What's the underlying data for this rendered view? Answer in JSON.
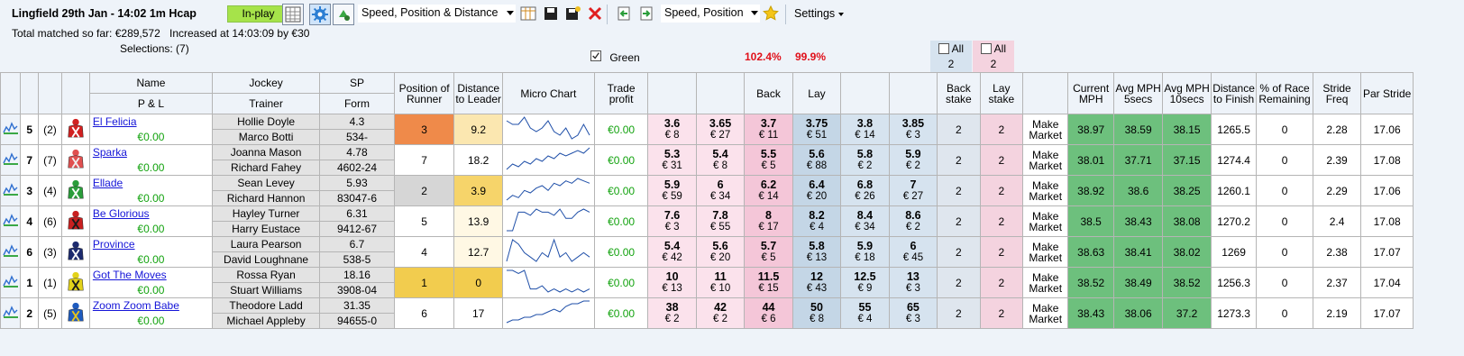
{
  "header": {
    "race_title": "Lingfield 29th Jan - 14:02 1m Hcap",
    "status": "In-play",
    "view_select": "Speed, Position & Distance",
    "layout_select": "Speed, Position",
    "settings": "Settings",
    "total_matched": "Total matched so far: €289,572",
    "increased": "Increased at 14:03:09 by €30",
    "selections": "Selections: (7)",
    "green_label": "Green",
    "back_book": "102.4%",
    "lay_book": "99.9%",
    "all_back_label": "All",
    "all_back_value": "2",
    "all_lay_label": "All",
    "all_lay_value": "2"
  },
  "columns": {
    "name": "Name",
    "pl": "P & L",
    "jockey": "Jockey",
    "trainer": "Trainer",
    "sp": "SP",
    "form": "Form",
    "position": "Position of Runner",
    "distance_leader": "Distance to Leader",
    "micro_chart": "Micro Chart",
    "trade_profit": "Trade profit",
    "back": "Back",
    "lay": "Lay",
    "back_stake": "Back stake",
    "lay_stake": "Lay stake",
    "current_mph": "Current MPH",
    "avg5": "Avg MPH 5secs",
    "avg10": "Avg MPH 10secs",
    "dist_finish": "Distance to Finish",
    "pct_remaining": "% of Race Remaining",
    "stride_freq": "Stride Freq",
    "par_stride": "Par Stride"
  },
  "runners": [
    {
      "num": "5",
      "draw": "(2)",
      "name": "El Felicia",
      "pl": "€0.00",
      "jockey": "Hollie Doyle",
      "trainer": "Marco Botti",
      "sp": "4.3",
      "form": "534-",
      "position": "3",
      "pos_color": "#ef8a4a",
      "dist": "9.2",
      "dist_color": "#fbe7b0",
      "trade": "€0.00",
      "odds": [
        [
          "3.6",
          "€ 8"
        ],
        [
          "3.65",
          "€ 27"
        ],
        [
          "3.7",
          "€ 11"
        ],
        [
          "3.75",
          "€ 51"
        ],
        [
          "3.8",
          "€ 14"
        ],
        [
          "3.85",
          "€ 3"
        ]
      ],
      "back_stake": "2",
      "lay_stake": "2",
      "mm": "Make Market",
      "mph": "38.97",
      "avg5": "38.59",
      "avg10": "38.15",
      "dfin": "1265.5",
      "rem": "0",
      "sf": "2.28",
      "ps": "17.06",
      "silks": [
        "#d12020",
        "#ffffff"
      ],
      "chart": [
        8,
        7,
        7,
        9,
        6,
        5,
        6,
        8,
        5,
        4,
        6,
        3,
        4,
        7,
        4
      ]
    },
    {
      "num": "7",
      "draw": "(7)",
      "name": "Sparka",
      "pl": "€0.00",
      "jockey": "Joanna Mason",
      "trainer": "Richard Fahey",
      "sp": "4.78",
      "form": "4602-24",
      "position": "7",
      "pos_color": "#ffffff",
      "dist": "18.2",
      "dist_color": "#ffffff",
      "trade": "€0.00",
      "odds": [
        [
          "5.3",
          "€ 31"
        ],
        [
          "5.4",
          "€ 8"
        ],
        [
          "5.5",
          "€ 5"
        ],
        [
          "5.6",
          "€ 88"
        ],
        [
          "5.8",
          "€ 2"
        ],
        [
          "5.9",
          "€ 2"
        ]
      ],
      "back_stake": "2",
      "lay_stake": "2",
      "mm": "Make Market",
      "mph": "38.01",
      "avg5": "37.71",
      "avg10": "37.15",
      "dfin": "1274.4",
      "rem": "0",
      "sf": "2.39",
      "ps": "17.08",
      "silks": [
        "#e05050",
        "#f0f0f0"
      ],
      "chart": [
        3,
        5,
        4,
        6,
        5,
        7,
        6,
        8,
        7,
        9,
        8,
        9,
        10,
        9,
        11
      ]
    },
    {
      "num": "3",
      "draw": "(4)",
      "name": "Ellade",
      "pl": "€0.00",
      "jockey": "Sean Levey",
      "trainer": "Richard Hannon",
      "sp": "5.93",
      "form": "83047-6",
      "position": "2",
      "pos_color": "#d6d6d6",
      "dist": "3.9",
      "dist_color": "#f6d46a",
      "trade": "€0.00",
      "odds": [
        [
          "5.9",
          "€ 59"
        ],
        [
          "6",
          "€ 34"
        ],
        [
          "6.2",
          "€ 14"
        ],
        [
          "6.4",
          "€ 20"
        ],
        [
          "6.8",
          "€ 26"
        ],
        [
          "7",
          "€ 27"
        ]
      ],
      "back_stake": "2",
      "lay_stake": "2",
      "mm": "Make Market",
      "mph": "38.92",
      "avg5": "38.6",
      "avg10": "38.25",
      "dfin": "1260.1",
      "rem": "0",
      "sf": "2.29",
      "ps": "17.06",
      "silks": [
        "#2a9d3a",
        "#ffffff"
      ],
      "chart": [
        2,
        4,
        3,
        6,
        5,
        7,
        8,
        6,
        9,
        8,
        10,
        9,
        11,
        10,
        9
      ]
    },
    {
      "num": "4",
      "draw": "(6)",
      "name": "Be Glorious",
      "pl": "€0.00",
      "jockey": "Hayley Turner",
      "trainer": "Harry Eustace",
      "sp": "6.31",
      "form": "9412-67",
      "position": "5",
      "pos_color": "#ffffff",
      "dist": "13.9",
      "dist_color": "#fff8e4",
      "trade": "€0.00",
      "odds": [
        [
          "7.6",
          "€ 3"
        ],
        [
          "7.8",
          "€ 55"
        ],
        [
          "8",
          "€ 17"
        ],
        [
          "8.2",
          "€ 4"
        ],
        [
          "8.4",
          "€ 34"
        ],
        [
          "8.6",
          "€ 2"
        ]
      ],
      "back_stake": "2",
      "lay_stake": "2",
      "mm": "Make Market",
      "mph": "38.5",
      "avg5": "38.43",
      "avg10": "38.08",
      "dfin": "1270.2",
      "rem": "0",
      "sf": "2.4",
      "ps": "17.08",
      "silks": [
        "#c81f1f",
        "#1a1a1a"
      ],
      "chart": [
        3,
        3,
        9,
        9,
        8,
        10,
        9,
        9,
        8,
        10,
        7,
        7,
        9,
        10,
        9
      ]
    },
    {
      "num": "6",
      "draw": "(3)",
      "name": "Province",
      "pl": "€0.00",
      "jockey": "Laura Pearson",
      "trainer": "David Loughnane",
      "sp": "6.7",
      "form": "538-5",
      "position": "4",
      "pos_color": "#ffffff",
      "dist": "12.7",
      "dist_color": "#fff8e4",
      "trade": "€0.00",
      "odds": [
        [
          "5.4",
          "€ 42"
        ],
        [
          "5.6",
          "€ 20"
        ],
        [
          "5.7",
          "€ 5"
        ],
        [
          "5.8",
          "€ 13"
        ],
        [
          "5.9",
          "€ 18"
        ],
        [
          "6",
          "€ 45"
        ]
      ],
      "back_stake": "2",
      "lay_stake": "2",
      "mm": "Make Market",
      "mph": "38.63",
      "avg5": "38.41",
      "avg10": "38.02",
      "dfin": "1269",
      "rem": "0",
      "sf": "2.38",
      "ps": "17.07",
      "silks": [
        "#1c2a6e",
        "#ffffff"
      ],
      "chart": [
        4,
        9,
        8,
        6,
        5,
        4,
        6,
        5,
        9,
        5,
        6,
        4,
        5,
        6,
        5
      ]
    },
    {
      "num": "1",
      "draw": "(1)",
      "name": "Got The Moves",
      "pl": "€0.00",
      "jockey": "Rossa Ryan",
      "trainer": "Stuart Williams",
      "sp": "18.16",
      "form": "3908-04",
      "position": "1",
      "pos_color": "#f2cc4e",
      "dist": "0",
      "dist_color": "#f2cc4e",
      "trade": "€0.00",
      "odds": [
        [
          "10",
          "€ 13"
        ],
        [
          "11",
          "€ 10"
        ],
        [
          "11.5",
          "€ 15"
        ],
        [
          "12",
          "€ 43"
        ],
        [
          "12.5",
          "€ 9"
        ],
        [
          "13",
          "€ 3"
        ]
      ],
      "back_stake": "2",
      "lay_stake": "2",
      "mm": "Make Market",
      "mph": "38.52",
      "avg5": "38.49",
      "avg10": "38.52",
      "dfin": "1256.3",
      "rem": "0",
      "sf": "2.37",
      "ps": "17.04",
      "silks": [
        "#e3d21a",
        "#1a1a1a"
      ],
      "chart": [
        10,
        10,
        9,
        10,
        4,
        4,
        5,
        3,
        4,
        3,
        4,
        3,
        4,
        3,
        4
      ]
    },
    {
      "num": "2",
      "draw": "(5)",
      "name": "Zoom Zoom Babe",
      "pl": "€0.00",
      "jockey": "Theodore Ladd",
      "trainer": "Michael Appleby",
      "sp": "31.35",
      "form": "94655-0",
      "position": "6",
      "pos_color": "#ffffff",
      "dist": "17",
      "dist_color": "#ffffff",
      "trade": "€0.00",
      "odds": [
        [
          "38",
          "€ 2"
        ],
        [
          "42",
          "€ 2"
        ],
        [
          "44",
          "€ 6"
        ],
        [
          "50",
          "€ 8"
        ],
        [
          "55",
          "€ 4"
        ],
        [
          "65",
          "€ 3"
        ]
      ],
      "back_stake": "2",
      "lay_stake": "2",
      "mm": "Make Market",
      "mph": "38.43",
      "avg5": "38.06",
      "avg10": "37.2",
      "dfin": "1273.3",
      "rem": "0",
      "sf": "2.19",
      "ps": "17.07",
      "silks": [
        "#1e5bbf",
        "#e6c51a"
      ],
      "chart": [
        2,
        3,
        3,
        4,
        4,
        5,
        5,
        6,
        7,
        6,
        8,
        9,
        9,
        10,
        10
      ]
    }
  ]
}
